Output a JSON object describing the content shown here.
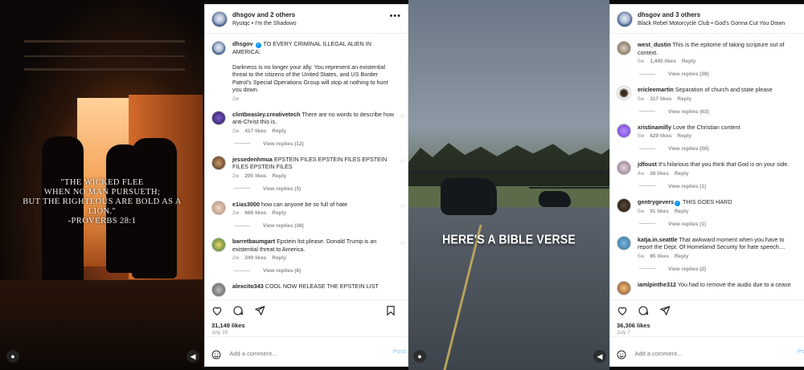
{
  "left": {
    "media": {
      "quote": [
        "\"THE WICKED FLEE",
        "WHEN NO MAN PURSUETH;",
        "BUT THE RIGHTEOUS ARE BOLD AS A LION.\"",
        "-PROVERBS 28:1"
      ]
    },
    "header": {
      "title": "dhsgov and 2 others",
      "subtitle": "Ryutqc • I'm the Shadows"
    },
    "caption": {
      "username": "dhsgov",
      "headline": "TO EVERY CRIMINAL ILLEGAL ALIEN IN AMERICA:",
      "body": "Darkness is no longer your ally. You represent an existential threat to the citizens of the United States, and US Border Patrol's Special Operations Group will stop at nothing to hunt you down.",
      "age": "2w"
    },
    "comments": [
      {
        "username": "clintbeasley.creativetech",
        "text": "There are no words to describe how anti-Christ this is.",
        "age": "2w",
        "likes": "417 likes",
        "reply": "Reply",
        "replies": "View replies (12)"
      },
      {
        "username": "jessedenhmua",
        "text": "EPSTEIN FILES EPSTEIN FILES EPSTEIN FILES EPSTEIN FILES",
        "age": "2w",
        "likes": "295 likes",
        "reply": "Reply",
        "replies": "View replies (3)"
      },
      {
        "username": "e1ias3000",
        "text": "how can anyone be so full of hate",
        "age": "2w",
        "likes": "668 likes",
        "reply": "Reply",
        "replies": "View replies (38)"
      },
      {
        "username": "barretbaumgart",
        "text": "Epstein list please. Donald Trump is an existential threat to America.",
        "age": "2w",
        "likes": "249 likes",
        "reply": "Reply",
        "replies": "View replies (8)"
      },
      {
        "username": "alexcito343",
        "text": "COOL NOW RELEASE THE EPSTEIN LIST",
        "age": "",
        "likes": "",
        "reply": "",
        "replies": ""
      }
    ],
    "likes": "31,149 likes",
    "date": "July 28",
    "add_comment_placeholder": "Add a comment...",
    "post_label": "Post"
  },
  "right": {
    "media": {
      "caption": "HERE'S A BIBLE VERSE"
    },
    "header": {
      "title": "dhsgov and 3 others",
      "subtitle": "Black Rebel Motorcycle Club • God's Gonna Cut You Down"
    },
    "comments": [
      {
        "username": "west_dustin",
        "text": "This is the epitome of taking scripture out of context.",
        "age": "5w",
        "likes": "1,445 likes",
        "reply": "Reply",
        "replies": "View replies (38)",
        "verified": false
      },
      {
        "username": "ericleemartin",
        "text": "Separation of church and state please",
        "age": "5w",
        "likes": "317 likes",
        "reply": "Reply",
        "replies": "View replies (63)",
        "verified": false
      },
      {
        "username": "xristinamilly",
        "text": "Love the Christian content",
        "age": "5w",
        "likes": "629 likes",
        "reply": "Reply",
        "replies": "View replies (50)",
        "verified": false
      },
      {
        "username": "jdfoust",
        "text": "It's hilarious that you think that God is on your side.",
        "age": "4w",
        "likes": "28 likes",
        "reply": "Reply",
        "replies": "View replies (1)",
        "verified": false
      },
      {
        "username": "gentrygevers",
        "text": "THIS GOES HARD",
        "age": "5w",
        "likes": "91 likes",
        "reply": "Reply",
        "replies": "View replies (1)",
        "verified": true
      },
      {
        "username": "katja.in.seattle",
        "text": "That awkward moment when you have to report the Dept. Of Homelamd Security for hate speech....",
        "age": "5w",
        "likes": "85 likes",
        "reply": "Reply",
        "replies": "View replies (2)",
        "verified": false
      },
      {
        "username": "iamlpinthe312",
        "text": "You had to remove the audio due to a cease",
        "age": "",
        "likes": "",
        "reply": "",
        "replies": "",
        "verified": false
      }
    ],
    "likes": "36,306 likes",
    "date": "July 7",
    "add_comment_placeholder": "Add a comment...",
    "post_label": "Post"
  },
  "icons": [
    "heart-icon",
    "comment-icon",
    "share-icon",
    "bookmark-icon",
    "emoji-icon",
    "more-icon",
    "verified-icon",
    "profile-icon",
    "mute-icon"
  ],
  "colors": {
    "accent": "#0095f6",
    "text": "#262626",
    "muted": "#8e8e8e"
  }
}
